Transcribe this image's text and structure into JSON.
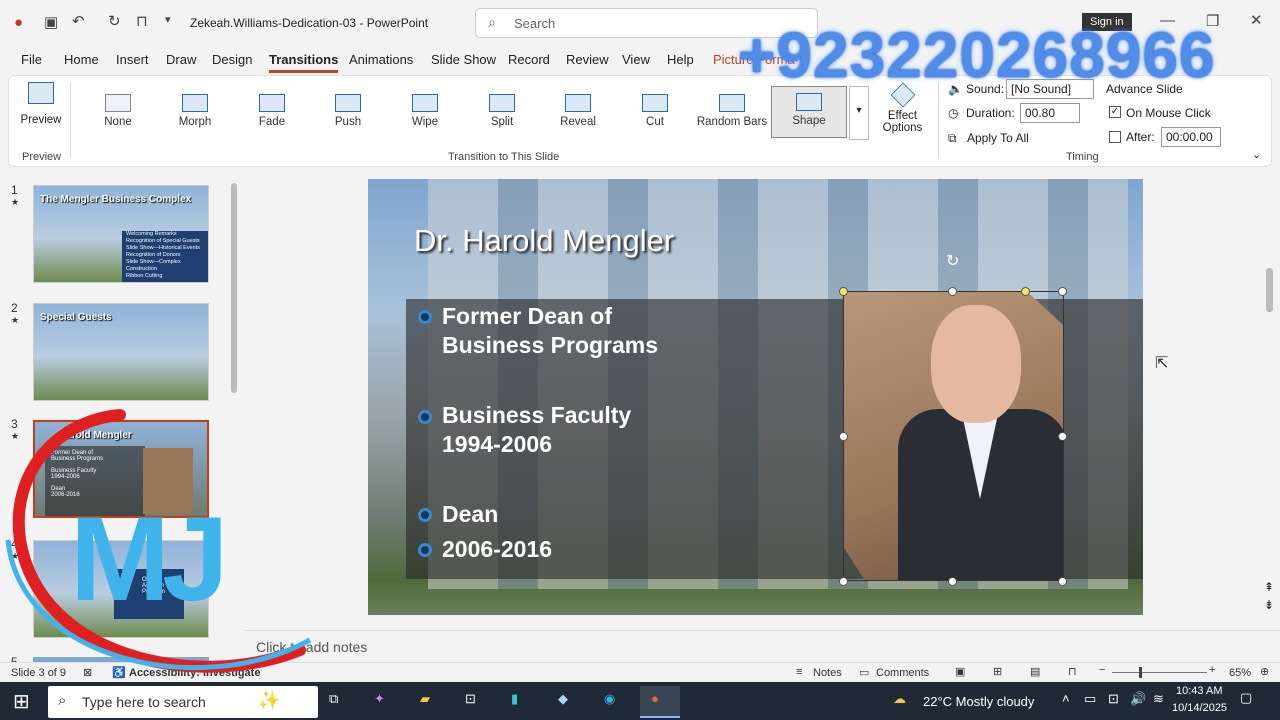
{
  "window": {
    "title": "Zekeah.Williams-Dedication-03  -  PowerPoint",
    "search_placeholder": "Search",
    "sign_in": "Sign in"
  },
  "menu": [
    "File",
    "Home",
    "Insert",
    "Draw",
    "Design",
    "Transitions",
    "Animations",
    "Slide Show",
    "Record",
    "Review",
    "View",
    "Help",
    "Picture Forma"
  ],
  "ribbon": {
    "preview_label": "Preview",
    "preview_group": "Preview",
    "transitions": [
      "None",
      "Morph",
      "Fade",
      "Push",
      "Wipe",
      "Split",
      "Reveal",
      "Cut",
      "Random Bars",
      "Shape"
    ],
    "selected_transition": "Shape",
    "transition_group": "Transition to This Slide",
    "effect_options": "Effect Options",
    "sound_label": "Sound:",
    "sound_value": "[No Sound]",
    "duration_label": "Duration:",
    "duration_value": "00.80",
    "apply_to_all": "Apply To All",
    "advance_slide": "Advance Slide",
    "on_mouse_click": "On Mouse Click",
    "after_label": "After:",
    "after_value": "00:00.00",
    "timing_group": "Timing"
  },
  "thumbnails": [
    {
      "num": "1",
      "star": "★",
      "title": "The Mengler Business Complex",
      "items": [
        "Welcoming Remarks",
        "Recognition of Special Guests",
        "Slide Show—Historical Events",
        "Recognition of Donors",
        "Slide Show—Complex Construction",
        "Ribbon Cutting"
      ]
    },
    {
      "num": "2",
      "star": "★",
      "title": "Special Guests",
      "items": []
    },
    {
      "num": "3",
      "star": "★",
      "title": "Harold Mengler",
      "items": [
        "Former Dean of",
        "Business Programs",
        "Business Faculty",
        "1994-2006",
        "Dean",
        "2006-2016"
      ]
    },
    {
      "num": "4",
      "star": "★",
      "title": "",
      "items": [
        "Online",
        "Academ",
        "Program"
      ]
    },
    {
      "num": "5",
      "star": "",
      "title": "",
      "items": []
    }
  ],
  "slide": {
    "title": "Dr. Harold Mengler",
    "bullets": [
      {
        "line1": "Former Dean of",
        "line2": "Business Programs"
      },
      {
        "line1": "Business Faculty",
        "line2": "1994-2006"
      },
      {
        "line1": "Dean",
        "line2": ""
      },
      {
        "line1": "2006-2016",
        "line2": ""
      }
    ]
  },
  "notes_placeholder": "Click to add notes",
  "status": {
    "slide_of": "Slide 3 of 9",
    "accessibility": "Accessibility: Investigate",
    "notes": "Notes",
    "comments": "Comments",
    "zoom": "65%"
  },
  "taskbar": {
    "search_placeholder": "Type here to search",
    "weather": "22°C  Mostly cloudy",
    "time": "10:43 AM",
    "date": "10/14/2025"
  },
  "overlay": {
    "phone": "+923220268966",
    "logo": "MJ"
  },
  "colors": {
    "accent": "#b7472a",
    "selection_handle": "#ffffff",
    "taskbar": "#1f2a36"
  }
}
